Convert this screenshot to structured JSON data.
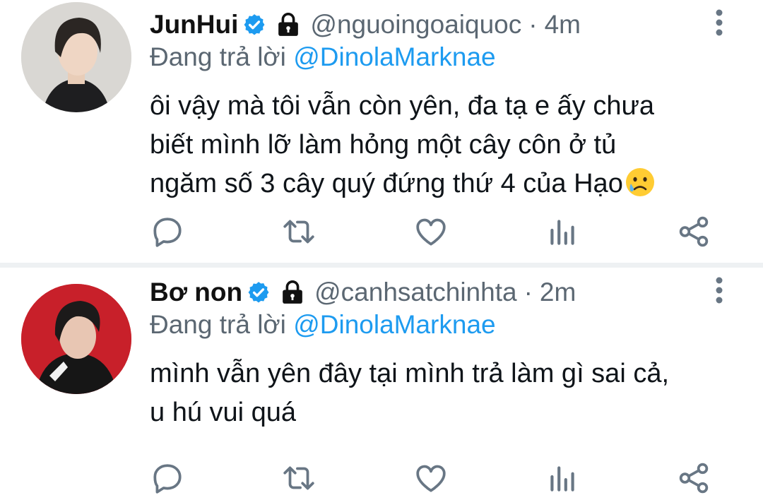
{
  "tweets": [
    {
      "name": "JunHui",
      "handle": "@nguoingoaiquoc",
      "separator": "·",
      "time": "4m",
      "reply_prefix": "Đang trả lời ",
      "reply_to": "@DinolaMarknae",
      "body_lines": [
        "ôi vậy mà tôi vẫn còn yên, đa tạ e ấy chưa",
        "biết mình lỡ làm hỏng một cây côn ở tủ",
        "ngăm số 3 cây quý đứng thứ 4 của Hạo"
      ],
      "emoji": "crying-face",
      "verified": true,
      "protected": true
    },
    {
      "name": "Bơ non",
      "handle": "@canhsatchinhta",
      "separator": "·",
      "time": "2m",
      "reply_prefix": "Đang trả lời ",
      "reply_to": "@DinolaMarknae",
      "body_lines": [
        "mình vẫn yên đây tại mình trả làm gì sai cả,",
        "u hú vui quá"
      ],
      "verified": true,
      "protected": true
    }
  ],
  "icons": [
    "verified-badge-icon",
    "lock-icon",
    "more-icon",
    "reply-icon",
    "retweet-icon",
    "like-icon",
    "stats-icon",
    "share-icon"
  ],
  "colors": {
    "accent": "#1d9bf0",
    "secondary_text": "#5b6772",
    "icon": "#687684",
    "divider": "#eef1f3"
  }
}
